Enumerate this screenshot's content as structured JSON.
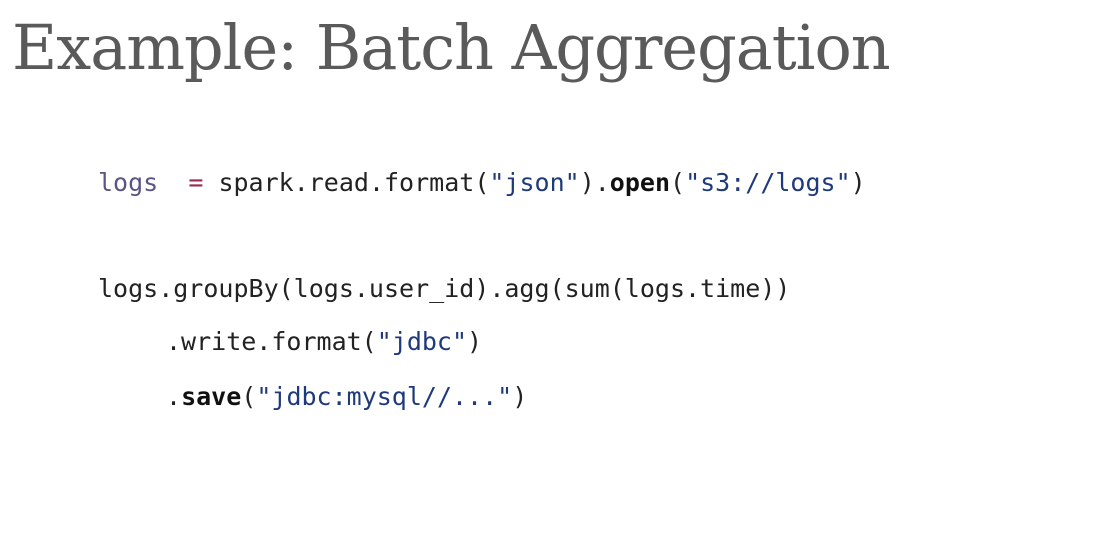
{
  "slide": {
    "title": "Example: Batch Aggregation"
  },
  "code": {
    "line1": {
      "var": "logs",
      "pad": "  ",
      "op": "=",
      "pre": " spark.read.format(",
      "str1": "\"json\"",
      "mid": ").",
      "kw": "open",
      "open_paren": "(",
      "str2": "\"s3://logs\"",
      "close": ")"
    },
    "line2": {
      "text": "logs.groupBy(logs.user_id).agg(sum(logs.time))"
    },
    "line3": {
      "pre": ".write.format(",
      "str": "\"jdbc\"",
      "close": ")"
    },
    "line4": {
      "dot": ".",
      "kw": "save",
      "open_paren": "(",
      "str": "\"jdbc:mysql//...\"",
      "close": ")"
    }
  }
}
